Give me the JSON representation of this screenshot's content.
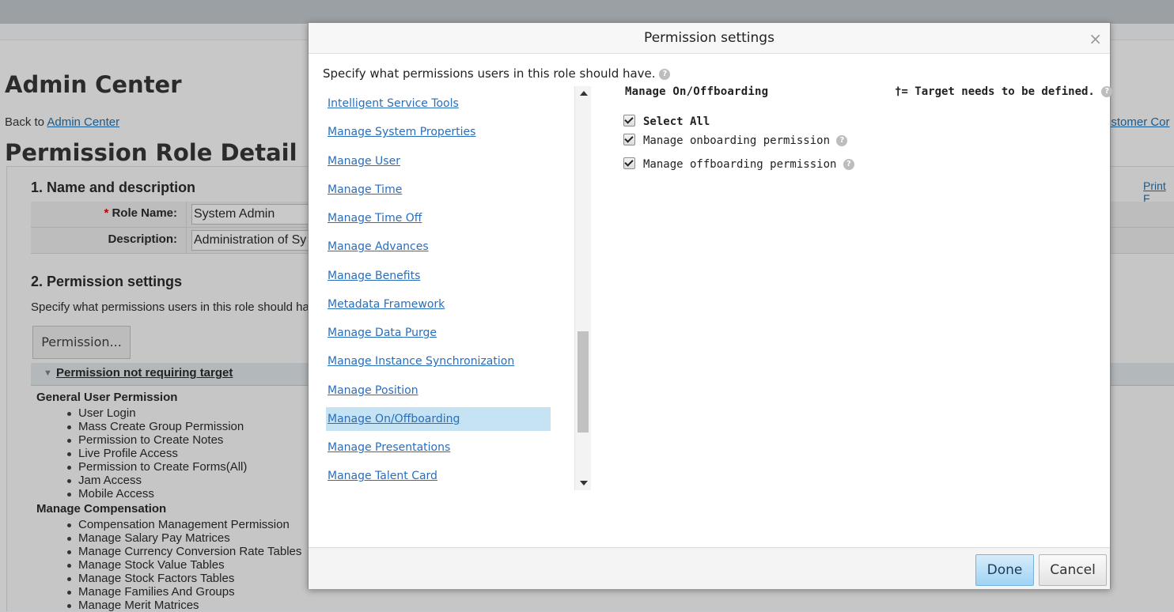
{
  "background": {
    "page_title": "Admin Center",
    "back_prefix": "Back to ",
    "back_link": "Admin Center",
    "customer_link": "ustomer Cor",
    "role_title": "Permission Role Detail",
    "print_link": "Print F",
    "section1_title": "1. Name and description",
    "role_name_label": "Role Name:",
    "role_name_value": "System Admin",
    "description_label": "Description:",
    "description_value": "Administration of Sy",
    "section2_title": "2. Permission settings",
    "section2_desc": "Specify what permissions users in this role should hav",
    "permission_button": "Permission...",
    "not_requiring_target": "Permission not requiring target",
    "groups": [
      {
        "title": "General User Permission",
        "items": [
          "User Login",
          "Mass Create Group Permission",
          "Permission to Create Notes",
          "Live Profile Access",
          "Permission to Create Forms(All)",
          "Jam Access",
          "Mobile Access"
        ]
      },
      {
        "title": "Manage Compensation",
        "items": [
          "Compensation Management Permission",
          "Manage Salary Pay Matrices",
          "Manage Currency Conversion Rate Tables",
          "Manage Stock Value Tables",
          "Manage Stock Factors Tables",
          "Manage Families And Groups",
          "Manage Merit Matrices"
        ]
      }
    ]
  },
  "modal": {
    "title": "Permission settings",
    "close": "×",
    "description": "Specify what permissions users in this role should have.",
    "categories": [
      "Intelligent Service Tools",
      "Manage System Properties",
      "Manage User",
      "Manage Time",
      "Manage Time Off",
      "Manage Advances",
      "Manage Benefits",
      "Metadata Framework",
      "Manage Data Purge",
      "Manage Instance Synchronization",
      "Manage Position",
      "Manage On/Offboarding",
      "Manage Presentations",
      "Manage Talent Card"
    ],
    "selected_category": "Manage On/Offboarding",
    "panel_title": "Manage On/Offboarding",
    "target_note": "†= Target needs to be defined.",
    "select_all": "Select All",
    "permissions": [
      "Manage onboarding permission",
      "Manage offboarding permission"
    ],
    "done_button": "Done",
    "cancel_button": "Cancel",
    "help_glyph": "?"
  }
}
